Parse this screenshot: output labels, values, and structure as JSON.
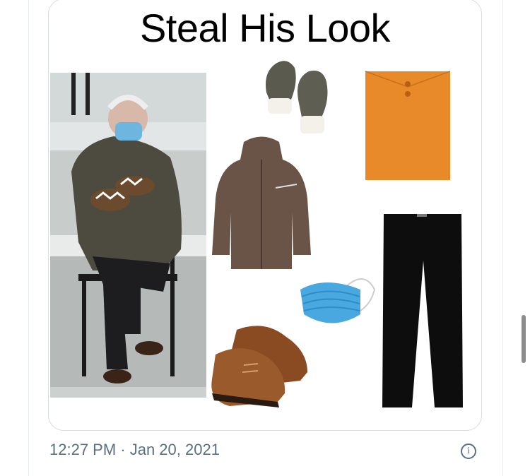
{
  "tweet": {
    "image_title": "Steal His Look",
    "timestamp": "12:27 PM · Jan 20, 2021",
    "info_glyph": "i"
  },
  "icons": {
    "info": "info-icon"
  },
  "colors": {
    "border": "#d7dde3",
    "meta_text": "#5b7083",
    "envelope": "#e88a2a",
    "mask": "#4aa8e0"
  }
}
